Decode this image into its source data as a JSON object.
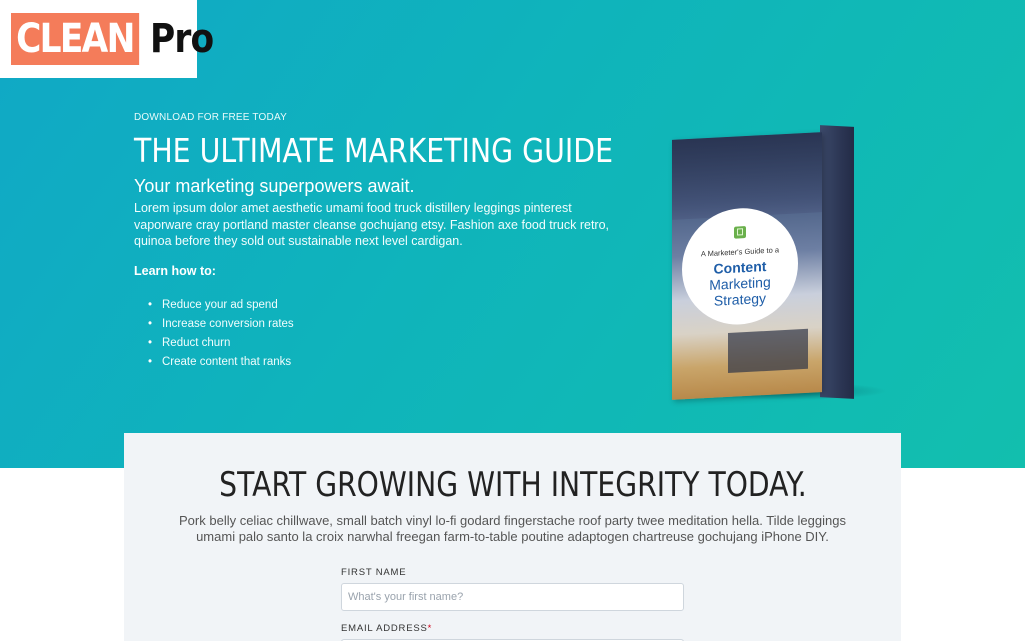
{
  "brand": {
    "logo_part1": "CLEAN",
    "logo_part2": "Pro",
    "accent": "#f47c5a"
  },
  "hero": {
    "eyebrow": "DOWNLOAD FOR FREE TODAY",
    "title": "THE ULTIMATE MARKETING GUIDE",
    "subtitle": "Your marketing superpowers await.",
    "body": "Lorem ipsum dolor amet aesthetic umami food truck distillery leggings pinterest vaporware cray portland master cleanse gochujang etsy. Fashion axe food truck retro, quinoa before they sold out sustainable next level cardigan.",
    "learn_label": "Learn how to:",
    "bullets": [
      "Reduce your ad spend",
      "Increase conversion rates",
      "Reduct churn",
      "Create content that ranks"
    ],
    "gradient_start": "#10a8c6",
    "gradient_end": "#12bfae"
  },
  "book": {
    "kicker": "A Marketer's Guide to a",
    "line1": "Content",
    "line2": "Marketing",
    "line3": "Strategy",
    "icon": "book-icon"
  },
  "form_card": {
    "title": "START GROWING WITH INTEGRITY TODAY.",
    "body": "Pork belly celiac chillwave, small batch vinyl lo-fi godard fingerstache roof party twee meditation hella. Tilde leggings umami palo santo la croix narwhal freegan farm-to-table poutine adaptogen chartreuse gochujang iPhone DIY.",
    "first_name": {
      "label": "FIRST NAME",
      "placeholder": "What's your first name?",
      "value": ""
    },
    "email": {
      "label": "EMAIL ADDRESS",
      "required_mark": "*",
      "placeholder": "",
      "value": ""
    }
  }
}
